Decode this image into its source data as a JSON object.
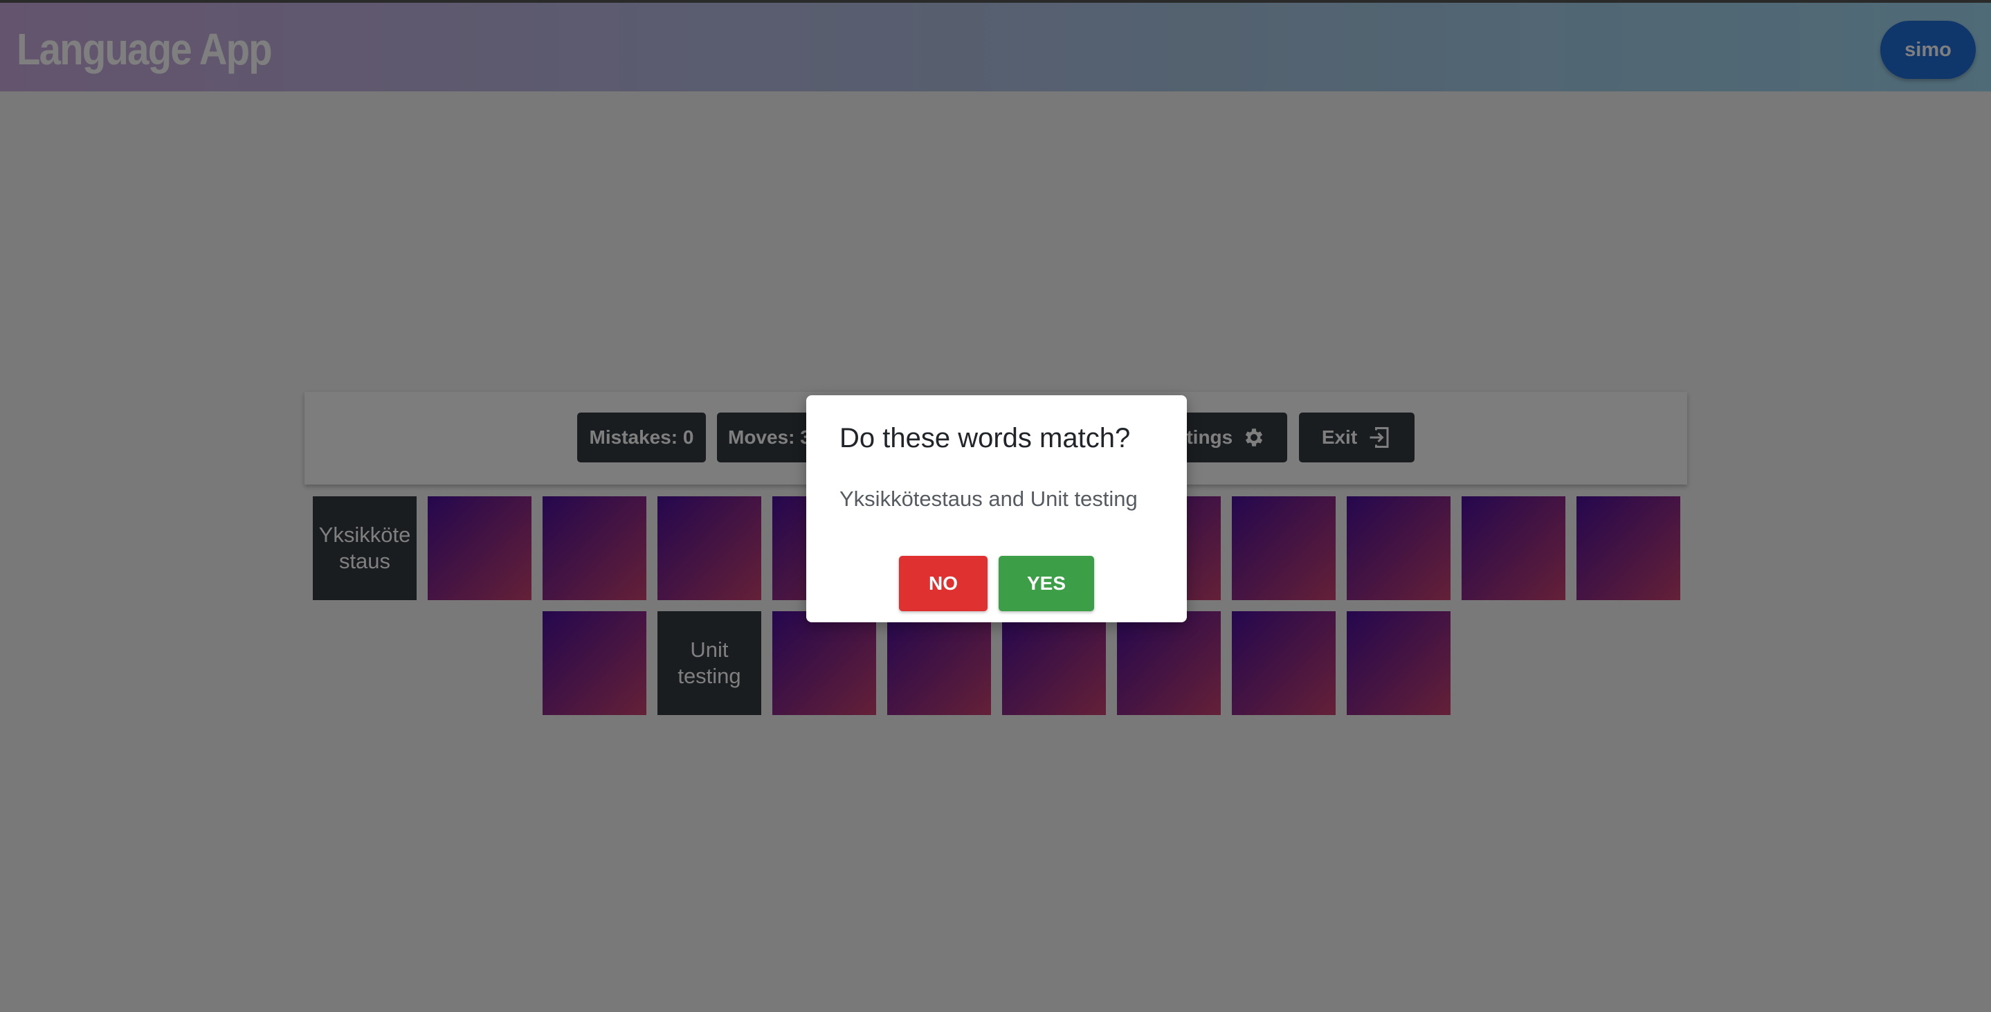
{
  "header": {
    "app_title": "Language App",
    "user_label": "simo"
  },
  "toolbar": {
    "mistakes_label": "Mistakes: 0",
    "moves_label": "Moves: 3",
    "settings_label": "Settings",
    "exit_label": "Exit"
  },
  "board": {
    "revealed_cards": [
      {
        "text": "Yksikkötestaus"
      },
      {
        "text": "Unit testing"
      }
    ],
    "card_back_colors": [
      "#4a0f9c",
      "#c9416f"
    ]
  },
  "dialog": {
    "title": "Do these words match?",
    "message": "Yksikkötestaus and Unit testing",
    "no_label": "NO",
    "yes_label": "YES"
  },
  "colors": {
    "user_button": "#1e6fd9",
    "no_button": "#e03131",
    "yes_button": "#3c9f47",
    "dark_button": "#343a40"
  }
}
